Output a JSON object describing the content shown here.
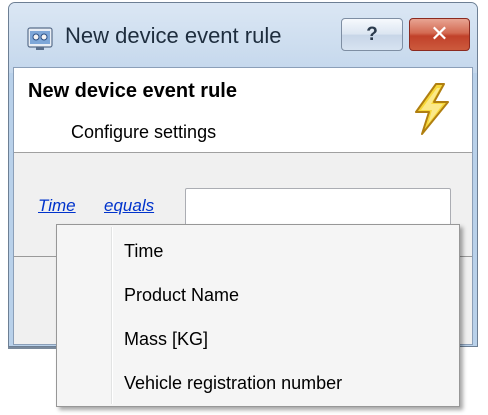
{
  "window": {
    "title": "New device event rule",
    "help_label": "?",
    "close_label": "✕"
  },
  "header": {
    "title": "New device event rule",
    "subtitle": "Configure settings",
    "icon": "lightning-bolt-icon"
  },
  "condition": {
    "field_link": "Time",
    "operator_link": "equals",
    "value": ""
  },
  "menu": {
    "items": [
      {
        "label": "Time"
      },
      {
        "label": "Product Name"
      },
      {
        "label": "Mass [KG]"
      },
      {
        "label": "Vehicle registration number"
      }
    ]
  },
  "colors": {
    "link": "#0033cc",
    "close_button": "#c1412a",
    "frame": "#b9d1ea"
  }
}
